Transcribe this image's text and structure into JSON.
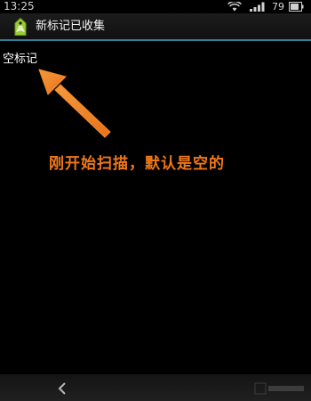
{
  "status_bar": {
    "time": "13:25",
    "battery_level": "79",
    "icons": [
      "wifi-icon",
      "signal-icon",
      "battery-icon"
    ]
  },
  "action_bar": {
    "title": "新标记已收集",
    "icon": "tag-icon",
    "divider_color": "#2f7f96"
  },
  "list": {
    "items": [
      {
        "label": "空标记"
      }
    ]
  },
  "annotation": {
    "text": "刚开始扫描，默认是空的",
    "color": "#f07818"
  },
  "nav_bar": {
    "icons": [
      "back-icon"
    ]
  }
}
